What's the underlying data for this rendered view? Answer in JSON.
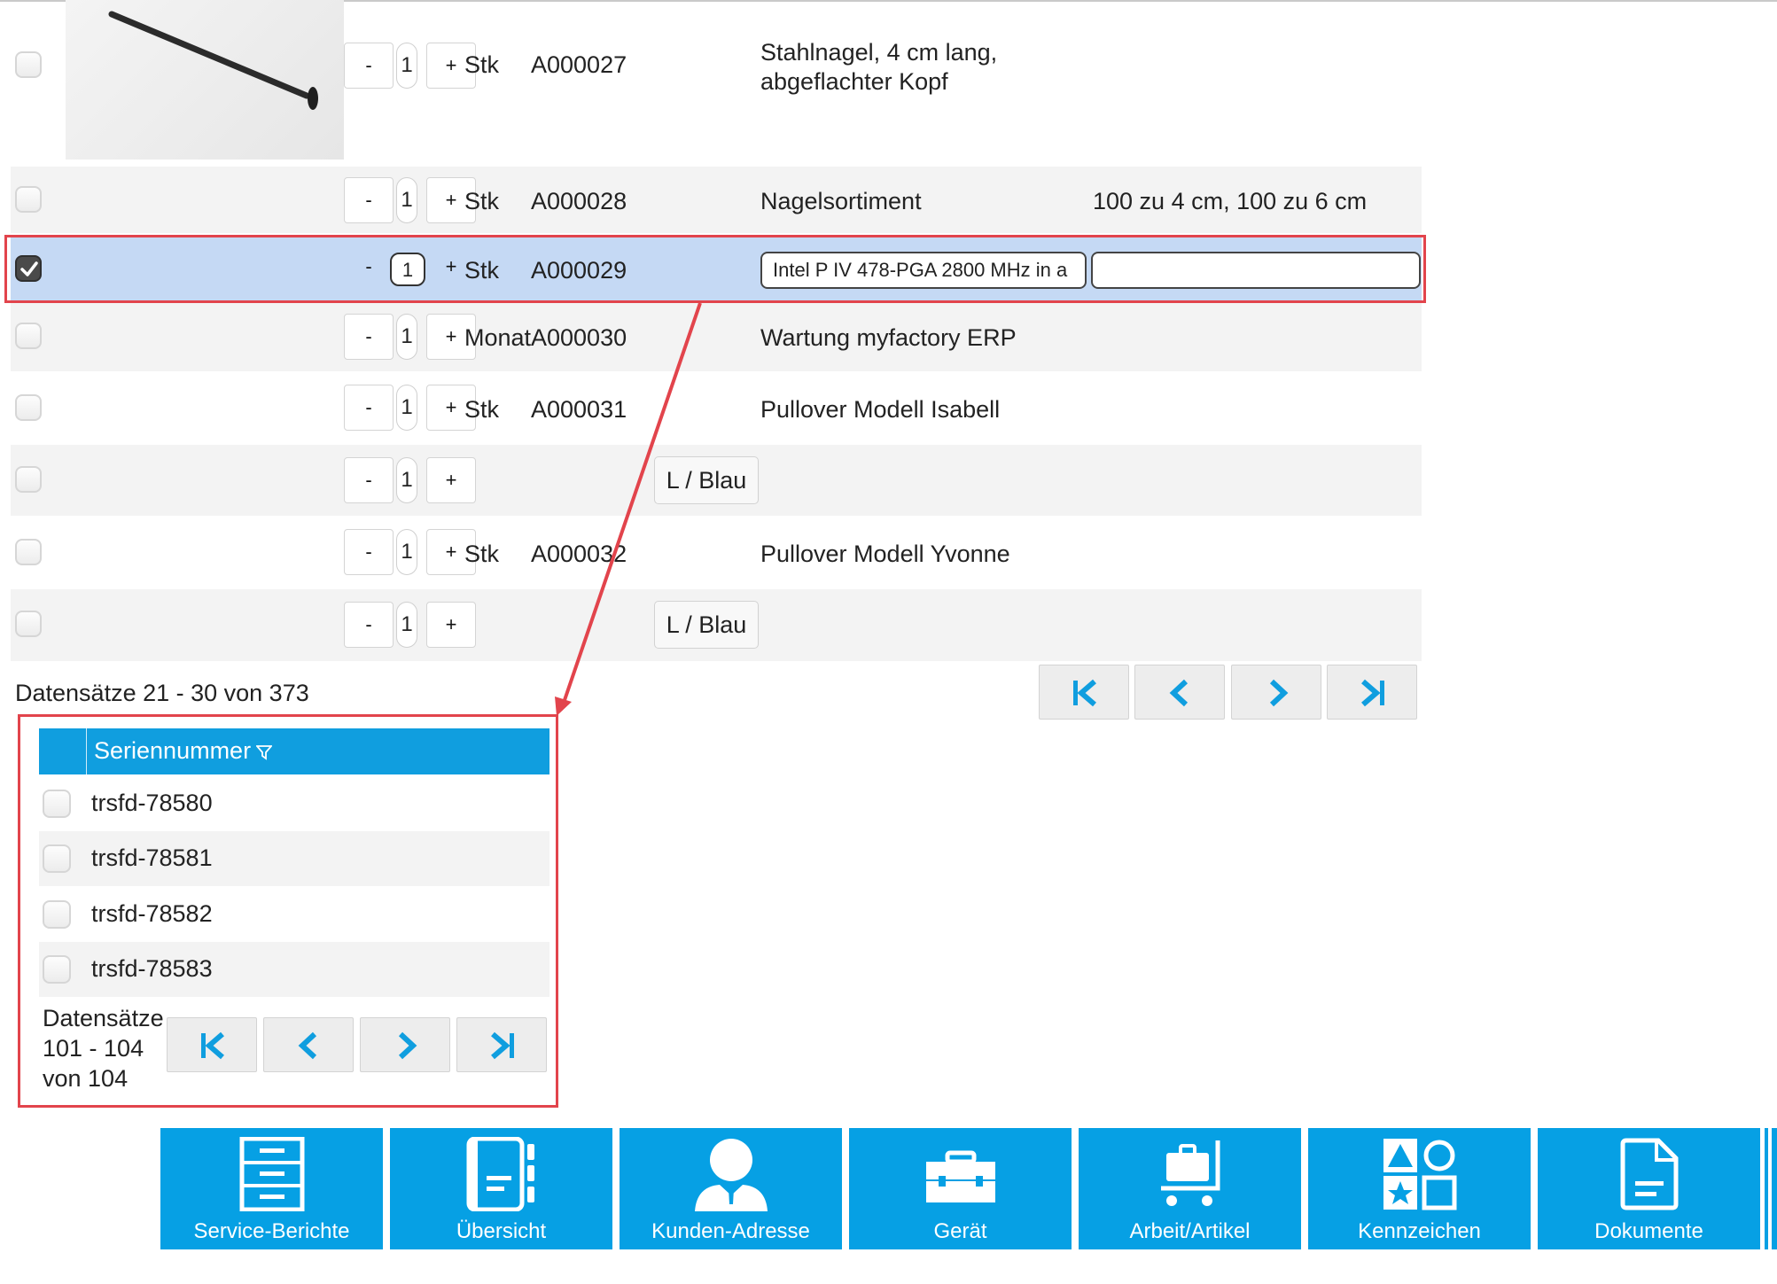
{
  "articles": [
    {
      "unit": "Stk",
      "article_no": "A000027",
      "description": "Stahlnagel, 4 cm lang,",
      "description_line2": "abgeflachter Kopf",
      "quantity": "1"
    },
    {
      "unit": "Stk",
      "article_no": "A000028",
      "description": "Nagelsortiment",
      "extra": "100 zu 4 cm, 100 zu 6 cm",
      "quantity": "1"
    },
    {
      "unit": "Stk",
      "article_no": "A000029",
      "description": "Intel P IV 478-PGA 2800 MHz in a",
      "quantity": "1",
      "extra": ""
    },
    {
      "unit": "Monat",
      "article_no": "A000030",
      "description": "Wartung myfactory ERP",
      "quantity": "1"
    },
    {
      "unit": "Stk",
      "article_no": "A000031",
      "description": "Pullover Modell Isabell",
      "quantity": "1"
    },
    {
      "variant": "L / Blau",
      "quantity": "1"
    },
    {
      "unit": "Stk",
      "article_no": "A000032",
      "description": "Pullover Modell Yvonne",
      "quantity": "1"
    },
    {
      "variant": "L / Blau",
      "quantity": "1"
    }
  ],
  "qty_buttons": {
    "minus": "-",
    "plus": "+"
  },
  "records_info": "Datensätze 21 - 30 von 373",
  "serial_popup": {
    "header": "Seriennummer",
    "items": [
      "trsfd-78580",
      "trsfd-78581",
      "trsfd-78582",
      "trsfd-78583"
    ],
    "records_line1": "Datensätze",
    "records_line2": "101 - 104",
    "records_line3": "von 104"
  },
  "toolbar": [
    {
      "label": "Service-Berichte",
      "icon": "cabinet-icon"
    },
    {
      "label": "Übersicht",
      "icon": "notebook-icon"
    },
    {
      "label": "Kunden-Adresse",
      "icon": "person-icon"
    },
    {
      "label": "Gerät",
      "icon": "toolbox-icon"
    },
    {
      "label": "Arbeit/Artikel",
      "icon": "cart-icon"
    },
    {
      "label": "Kennzeichen",
      "icon": "shapes-icon"
    },
    {
      "label": "Dokumente",
      "icon": "document-icon"
    }
  ],
  "colors": {
    "accent": "#06a0e4",
    "selected_row": "#c5d9f4",
    "highlight": "#e2444c"
  }
}
